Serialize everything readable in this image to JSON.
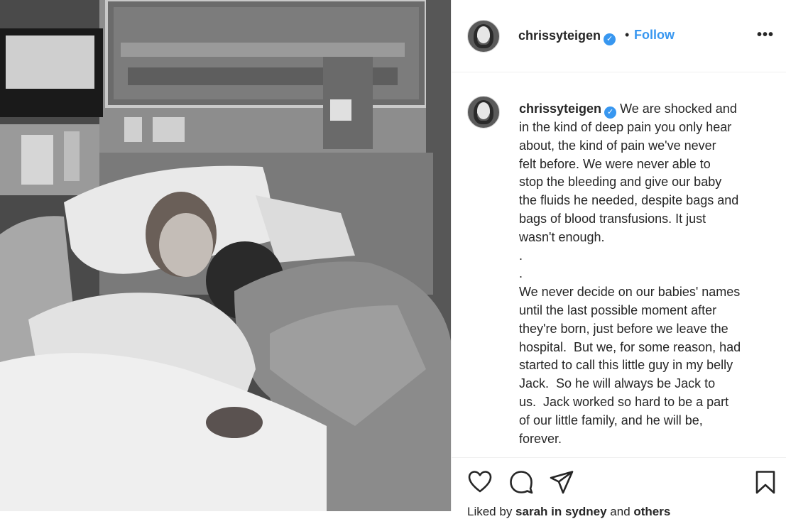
{
  "post": {
    "photo_alt": "Hospital photo",
    "username": "chrissyteigen",
    "verified_glyph": "✓",
    "separator": "•",
    "follow_label": "Follow",
    "more_label": "•••"
  },
  "caption": {
    "username": "chrissyteigen",
    "text": " We are shocked and\nin the kind of deep pain you only hear\nabout, the kind of pain we've never\nfelt before. We were never able to\nstop the bleeding and give our baby\nthe fluids he needed, despite bags and\nbags of blood transfusions. It just\nwasn't enough.\n.\n.\nWe never decide on our babies' names\nuntil the last possible moment after\nthey're born, just before we leave the\nhospital.  But we, for some reason, had\nstarted to call this little guy in my belly\nJack.  So he will always be Jack to\nus.  Jack worked so hard to be a part\nof our little family, and he will be,\nforever."
  },
  "actions": {
    "icons": [
      "heart-icon",
      "comment-icon",
      "share-icon",
      "bookmark-icon"
    ],
    "liked_prefix": "Liked by ",
    "liked_user": "sarah in sydney",
    "liked_and": " and ",
    "liked_others": "others"
  }
}
